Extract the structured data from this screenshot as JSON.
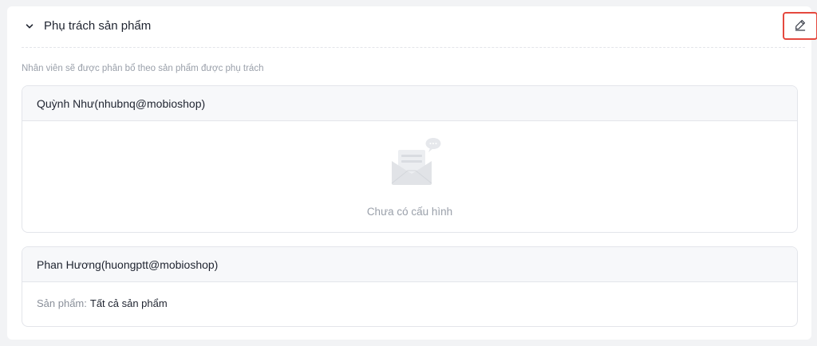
{
  "section": {
    "title": "Phụ trách sản phẩm",
    "description": "Nhân viên sẽ được phân bổ theo sản phẩm được phụ trách",
    "collapse_icon": "chevron-down-icon",
    "edit_icon": "pencil-icon"
  },
  "staff": [
    {
      "name": "Quỳnh Như(nhubnq@mobioshop)",
      "empty_text": "Chưa có cấu hình",
      "empty_icon": "empty-inbox-illustration"
    },
    {
      "name": "Phan Hương(huongptt@mobioshop)",
      "products_label": "Sản phẩm:",
      "products_value": "Tất cả sản phẩm"
    }
  ],
  "colors": {
    "highlight": "#e5483e",
    "muted_text": "#9aa0aa",
    "border": "#e3e5ea"
  }
}
